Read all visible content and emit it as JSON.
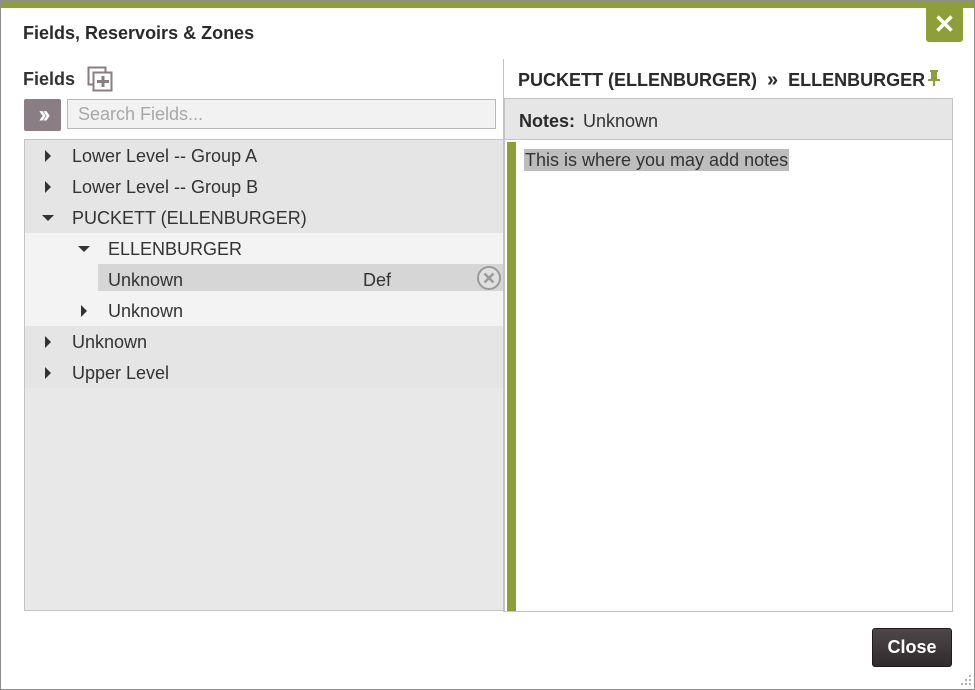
{
  "dialog": {
    "title": "Fields, Reservoirs & Zones",
    "close_x_icon": "close-x-icon",
    "accent_color": "#8e9f3a"
  },
  "left": {
    "fields_label": "Fields",
    "add_icon": "add-copy-icon",
    "expand_icon": "double-chevron-right-icon",
    "search_placeholder": "Search Fields...",
    "search_value": ""
  },
  "tree": {
    "items": [
      {
        "label": "Lower Level -- Group A",
        "level": 0,
        "state": "collapsed"
      },
      {
        "label": "Lower Level -- Group B",
        "level": 0,
        "state": "collapsed"
      },
      {
        "label": "PUCKETT (ELLENBURGER)",
        "level": 0,
        "state": "expanded"
      },
      {
        "label": "ELLENBURGER",
        "level": 1,
        "state": "expanded"
      },
      {
        "label": "Unknown",
        "level": 2,
        "state": "selected",
        "tag": "Def"
      },
      {
        "label": "Unknown",
        "level": 1,
        "state": "collapsed"
      },
      {
        "label": "Unknown",
        "level": 0,
        "state": "collapsed"
      },
      {
        "label": "Upper Level",
        "level": 0,
        "state": "collapsed"
      }
    ]
  },
  "right": {
    "breadcrumb_field": "PUCKETT (ELLENBURGER)",
    "breadcrumb_sep": "»",
    "breadcrumb_reservoir": "ELLENBURGER",
    "pin_icon": "pin-icon",
    "notes_label": "Notes:",
    "notes_value": "Unknown",
    "notes_text": "This is where you may add notes"
  },
  "footer": {
    "close_label": "Close"
  }
}
